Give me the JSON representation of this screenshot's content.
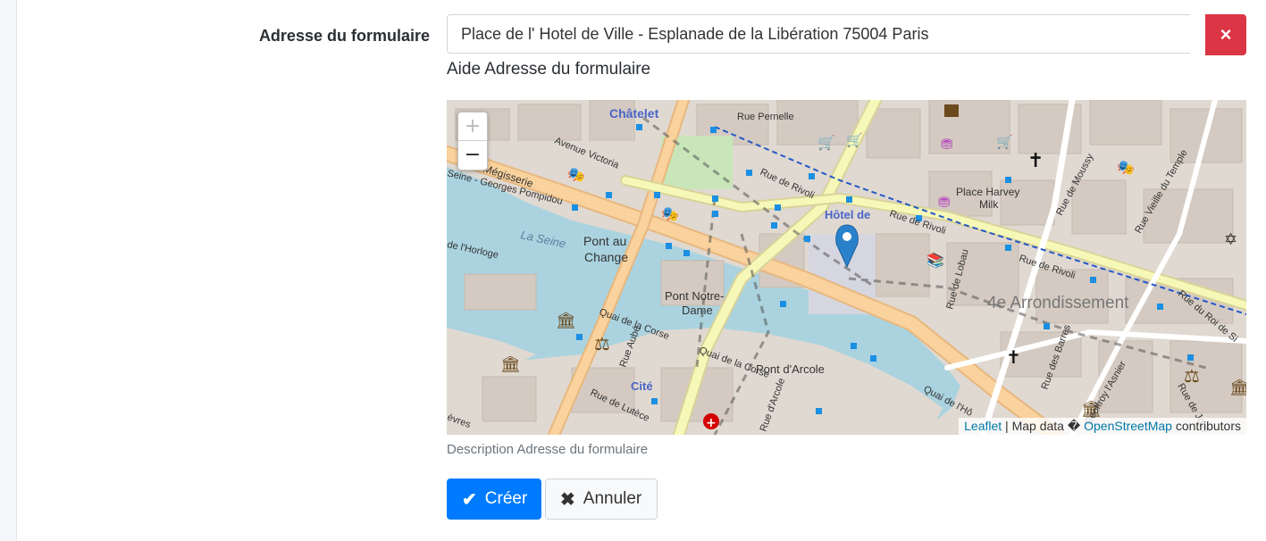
{
  "form": {
    "label": "Adresse du formulaire",
    "address_value": "Place de l' Hotel de Ville - Esplanade de la Libération 75004 Paris",
    "clear_icon": "×",
    "help": "Aide Adresse du formulaire",
    "description": "Description Adresse du formulaire"
  },
  "map": {
    "zoom_in": "+",
    "zoom_out": "−",
    "attribution_leaflet": "Leaflet",
    "attribution_mid": " | Map data � ",
    "attribution_osm": "OpenStreetMap",
    "attribution_end": " contributors",
    "labels": {
      "chatelet": "Châtelet",
      "avenue_victoria": "Avenue Victoria",
      "rue_pernelle": "Rue Pernelle",
      "megisserie": "Mégisserie",
      "pompidou": "Seine - Georges Pompidou",
      "rue_rivoli_1": "Rue de Rivoli",
      "rue_rivoli_2": "Rue de Rivoli",
      "rue_rivoli_3": "Rue de Rivoli",
      "hotel_de": "Hôtel de",
      "place_harvey_1": "Place Harvey",
      "place_harvey_2": "Milk",
      "rue_moussy": "Rue de Moussy",
      "vieille_temple": "Rue Vieille du Temple",
      "roi_de_sicile": "Rue du Roi de Si",
      "la_seine": "La Seine",
      "pont_au_1": "Pont au",
      "pont_au_2": "Change",
      "horloge": "de l'Horloge",
      "rue_lobau": "Rue de Lobau",
      "arrondissement": "4e Arrondissement",
      "pont_nd_1": "Pont Notre-",
      "pont_nd_2": "Dame",
      "quai_corse_1": "Quai de la Corse",
      "quai_corse_2": "Quai de la Corse",
      "rue_aube": "Rue Aubé",
      "pont_arcole": "Pont d'Arcole",
      "cite": "Cité",
      "rue_lutece": "Rue de Lutèce",
      "rue_arcole": "Rue d'Arcole",
      "quai_hotel": "Quai de l'Hô",
      "rue_barres": "Rue des Barres",
      "geoffroy": "Geoffroy l'Asnier",
      "rue_jouy": "Rue de Jouy",
      "evres": "èvres"
    }
  },
  "buttons": {
    "create_icon": "✔",
    "create": "Créer",
    "cancel_icon": "✖",
    "cancel": "Annuler"
  },
  "colors": {
    "primary": "#007bff",
    "danger": "#dc3545",
    "water": "#aad3df",
    "road_major": "#f7c58f",
    "road_secondary": "#f4f5b5",
    "building": "#d9d0c9",
    "marker": "#2a81cb"
  }
}
